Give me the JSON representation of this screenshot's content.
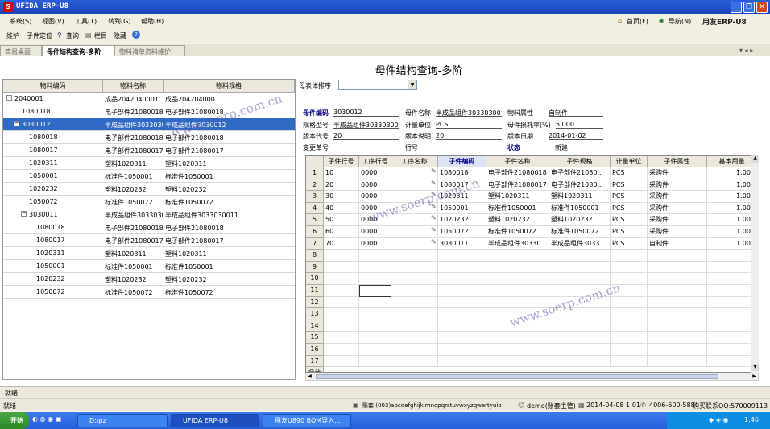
{
  "app": {
    "title": "UFIDA ERP-U8",
    "menus": [
      "系统(S)",
      "视图(V)",
      "工具(T)",
      "转到(G)",
      "帮助(H)"
    ],
    "right_links": [
      "首页(F)",
      "导航(N)",
      "用友ERP-U8"
    ],
    "toolbar": [
      "维护",
      "子件定位",
      "查询",
      "栏目",
      "隐藏"
    ],
    "tabs": [
      "简易桌面",
      "母件结构查询-多阶",
      "物料清单资料维护"
    ]
  },
  "page": {
    "title": "母件结构查询-多阶",
    "sort_label": "母表体排序"
  },
  "tree": {
    "columns": [
      "物料编码",
      "物料名称",
      "物料规格"
    ],
    "rows": [
      {
        "code": "2040001",
        "name": "成品2042040001",
        "spec": "成品2042040001",
        "expander": "-",
        "indent": 0
      },
      {
        "code": "1080018",
        "name": "电子部件21080018",
        "spec": "电子部件21080018",
        "expander": "",
        "indent": 1
      },
      {
        "code": "3030012",
        "name": "半成品组件3033030",
        "spec": "半成品组件3030012",
        "expander": "-",
        "indent": 1,
        "selected": true
      },
      {
        "code": "1080018",
        "name": "电子部件21080018",
        "spec": "电子部件21080018",
        "expander": "",
        "indent": 2
      },
      {
        "code": "1080017",
        "name": "电子部件21080017",
        "spec": "电子部件21080017",
        "expander": "",
        "indent": 2
      },
      {
        "code": "1020311",
        "name": "塑料1020311",
        "spec": "塑料1020311",
        "expander": "",
        "indent": 2
      },
      {
        "code": "1050001",
        "name": "标准件1050001",
        "spec": "标准件1050001",
        "expander": "",
        "indent": 2
      },
      {
        "code": "1020232",
        "name": "塑料1020232",
        "spec": "塑料1020232",
        "expander": "",
        "indent": 2
      },
      {
        "code": "1050072",
        "name": "标准件1050072",
        "spec": "标准件1050072",
        "expander": "",
        "indent": 2
      },
      {
        "code": "3030011",
        "name": "半成品组件3033030",
        "spec": "半成品组件3033030011",
        "expander": "-",
        "indent": 2
      },
      {
        "code": "1080018",
        "name": "电子部件21080018",
        "spec": "电子部件21080018",
        "expander": "",
        "indent": 3
      },
      {
        "code": "1080017",
        "name": "电子部件21080017",
        "spec": "电子部件21080017",
        "expander": "",
        "indent": 3
      },
      {
        "code": "1020311",
        "name": "塑料1020311",
        "spec": "塑料1020311",
        "expander": "",
        "indent": 3
      },
      {
        "code": "1050001",
        "name": "标准件1050001",
        "spec": "标准件1050001",
        "expander": "",
        "indent": 3
      },
      {
        "code": "1020232",
        "name": "塑料1020232",
        "spec": "塑料1020232",
        "expander": "",
        "indent": 3
      },
      {
        "code": "1050072",
        "name": "标准件1050072",
        "spec": "标准件1050072",
        "expander": "",
        "indent": 3
      }
    ]
  },
  "header_fields": {
    "parent_code_label": "母件编码",
    "parent_code": "3030012",
    "parent_name_label": "母件名称",
    "parent_name": "半成品组件30330300",
    "attr_label": "物料属性",
    "attr": "自制件",
    "spec_label": "规格型号",
    "spec": "半成品组件30330300",
    "unit_label": "计量单位",
    "unit": "PCS",
    "loss_label": "母件损耗率(%)",
    "loss": "5.000",
    "ver_code_label": "版本代号",
    "ver_code": "20",
    "ver_desc_label": "版本说明",
    "ver_desc": "20",
    "ver_date_label": "版本日期",
    "ver_date": "2014-01-02",
    "change_label": "变更单号",
    "change": "",
    "line_label": "行号",
    "line": "",
    "status_label": "状态",
    "status": "新建"
  },
  "grid": {
    "columns": [
      "子件行号",
      "工序行号",
      "工序名称",
      "子件编码",
      "子件名称",
      "子件规格",
      "计量单位",
      "子件属性",
      "基本用量"
    ],
    "rows": [
      [
        "10",
        "0000",
        "",
        "1080018",
        "电子部件21080018",
        "电子部件21080...",
        "PCS",
        "采购件",
        "1.000"
      ],
      [
        "20",
        "0000",
        "",
        "1080017",
        "电子部件21080017",
        "电子部件21080...",
        "PCS",
        "采购件",
        "1.000"
      ],
      [
        "30",
        "0000",
        "",
        "1020311",
        "塑料1020311",
        "塑料1020311",
        "PCS",
        "采购件",
        "1.000"
      ],
      [
        "40",
        "0000",
        "",
        "1050001",
        "标准件1050001",
        "标准件1050001",
        "PCS",
        "采购件",
        "1.000"
      ],
      [
        "50",
        "0000",
        "",
        "1020232",
        "塑料1020232",
        "塑料1020232",
        "PCS",
        "采购件",
        "1.000"
      ],
      [
        "60",
        "0000",
        "",
        "1050072",
        "标准件1050072",
        "标准件1050072",
        "PCS",
        "采购件",
        "1.000"
      ],
      [
        "70",
        "0000",
        "",
        "3030011",
        "半成品组件30330...",
        "半成品组件3033...",
        "PCS",
        "自制件",
        "1.000"
      ]
    ],
    "row_numbers": [
      "1",
      "2",
      "3",
      "4",
      "5",
      "6",
      "7",
      "8",
      "9",
      "10",
      "11",
      "12",
      "13",
      "14",
      "15",
      "16",
      "17"
    ],
    "total_label": "合计"
  },
  "status": {
    "ready": "就绪",
    "account": "账套:(003)abcdefghijklmnopqrstuvwxyzqwertyuio",
    "user": "demo(账套主管)",
    "date": "2014-04-08 1:01",
    "phone": "4006-600-588",
    "qq": "购买联系QQ:570009113"
  },
  "taskbar": {
    "start": "开始",
    "tasks": [
      "D:\\pz",
      "UFIDA ERP-U8",
      "用友U890 BOM导入..."
    ],
    "clock": "1:46"
  },
  "watermark": "www.soerp.com.cn"
}
